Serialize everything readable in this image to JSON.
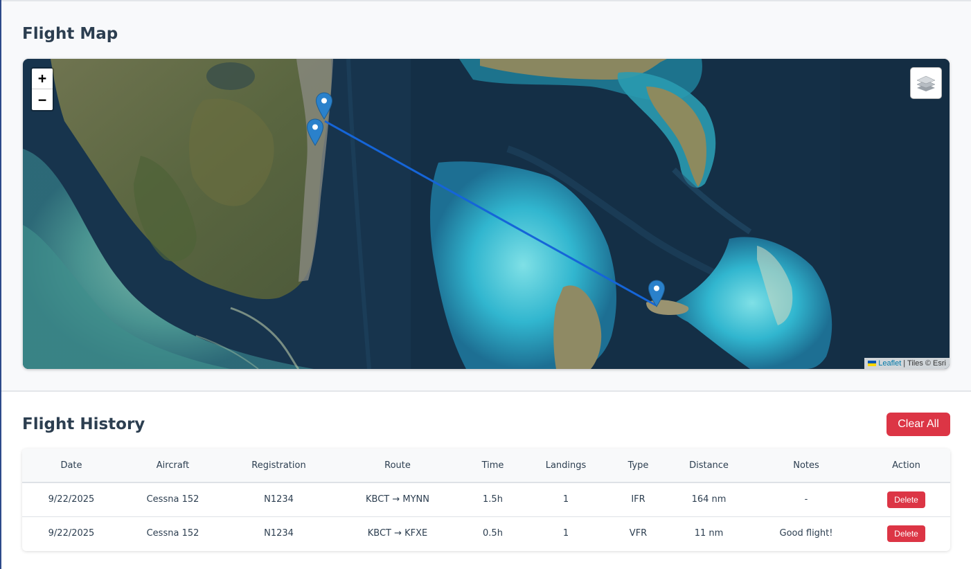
{
  "map_section": {
    "title": "Flight Map",
    "zoom_in": "+",
    "zoom_out": "−",
    "attribution": {
      "leaflet_link": "Leaflet",
      "tiles": "| Tiles © Esri"
    }
  },
  "history_section": {
    "title": "Flight History",
    "clear_all": "Clear All",
    "columns": [
      "Date",
      "Aircraft",
      "Registration",
      "Route",
      "Time",
      "Landings",
      "Type",
      "Distance",
      "Notes",
      "Action"
    ],
    "rows": [
      {
        "date": "9/22/2025",
        "aircraft": "Cessna 152",
        "registration": "N1234",
        "route": "KBCT → MYNN",
        "time": "1.5h",
        "landings": "1",
        "type": "IFR",
        "distance": "164 nm",
        "notes": "-",
        "action": "Delete"
      },
      {
        "date": "9/22/2025",
        "aircraft": "Cessna 152",
        "registration": "N1234",
        "route": "KBCT → KFXE",
        "time": "0.5h",
        "landings": "1",
        "type": "VFR",
        "distance": "11 nm",
        "notes": "Good flight!",
        "action": "Delete"
      }
    ]
  },
  "colors": {
    "accent_red": "#dc3545",
    "marker_blue": "#2a81cb",
    "route_line": "#1565d8",
    "heading": "#2c3e50"
  },
  "icons": {
    "map_markers": "map-marker-icon",
    "layers": "layers-icon",
    "flag": "ukraine-flag-icon"
  }
}
